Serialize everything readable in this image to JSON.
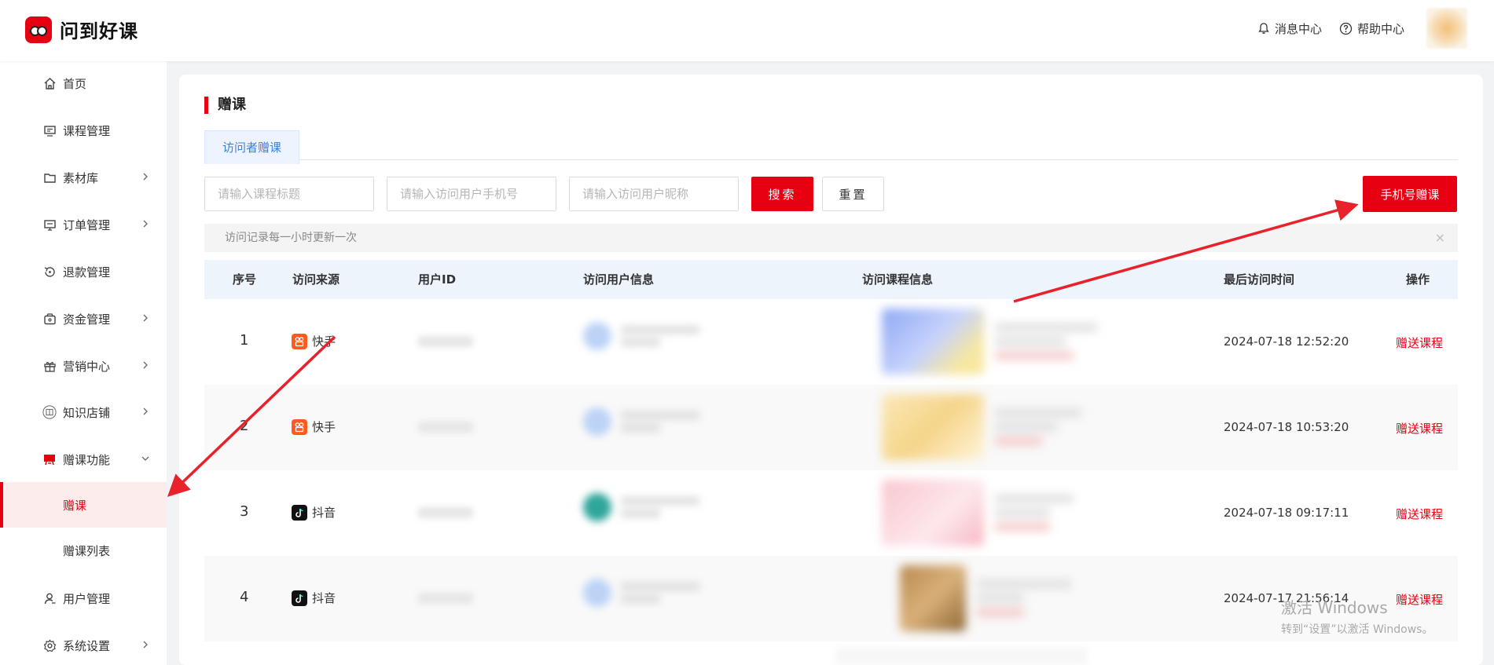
{
  "app": {
    "logo_text": "问到好课"
  },
  "header": {
    "messages_label": "消息中心",
    "help_label": "帮助中心"
  },
  "sidebar": {
    "items": [
      {
        "label": "首页",
        "icon": "home-icon"
      },
      {
        "label": "课程管理",
        "icon": "course-icon"
      },
      {
        "label": "素材库",
        "icon": "folder-icon"
      },
      {
        "label": "订单管理",
        "icon": "order-icon"
      },
      {
        "label": "退款管理",
        "icon": "refund-icon"
      },
      {
        "label": "资金管理",
        "icon": "wallet-icon"
      },
      {
        "label": "营销中心",
        "icon": "gift-icon"
      },
      {
        "label": "知识店铺",
        "icon": "store-icon"
      },
      {
        "label": "赠课功能",
        "icon": "gift-course-icon"
      },
      {
        "label": "用户管理",
        "icon": "user-icon"
      },
      {
        "label": "系统设置",
        "icon": "settings-icon"
      }
    ],
    "sub_items": [
      {
        "label": "赠课"
      },
      {
        "label": "赠课列表"
      }
    ]
  },
  "page": {
    "title": "赠课",
    "tab": "访问者赠课",
    "filters": {
      "course_title_placeholder": "请输入课程标题",
      "phone_placeholder": "请输入访问用户手机号",
      "nickname_placeholder": "请输入访问用户昵称",
      "search_label": "搜索",
      "reset_label": "重置"
    },
    "phone_gift_button": "手机号赠课",
    "notice": "访问记录每一小时更新一次",
    "notice_close": "×"
  },
  "table": {
    "columns": [
      "序号",
      "访问来源",
      "用户ID",
      "访问用户信息",
      "访问课程信息",
      "最后访问时间",
      "操作"
    ],
    "rows": [
      {
        "index": "1",
        "source": "快手",
        "source_icon": "kuaishou-icon",
        "last_visit": "2024-07-18 12:52:20",
        "action": "赠送课程"
      },
      {
        "index": "2",
        "source": "快手",
        "source_icon": "kuaishou-icon",
        "last_visit": "2024-07-18 10:53:20",
        "action": "赠送课程"
      },
      {
        "index": "3",
        "source": "抖音",
        "source_icon": "douyin-icon",
        "last_visit": "2024-07-18 09:17:11",
        "action": "赠送课程"
      },
      {
        "index": "4",
        "source": "抖音",
        "source_icon": "douyin-icon",
        "last_visit": "2024-07-17 21:56:14",
        "action": "赠送课程"
      }
    ]
  },
  "watermark": {
    "line1": "激活 Windows",
    "line2": "转到“设置”以激活 Windows。"
  },
  "colors": {
    "accent": "#e60012",
    "sidebar_active_bg": "#fdecec",
    "table_header_bg": "#eef4fc",
    "tab_bg": "#edf4ff"
  }
}
